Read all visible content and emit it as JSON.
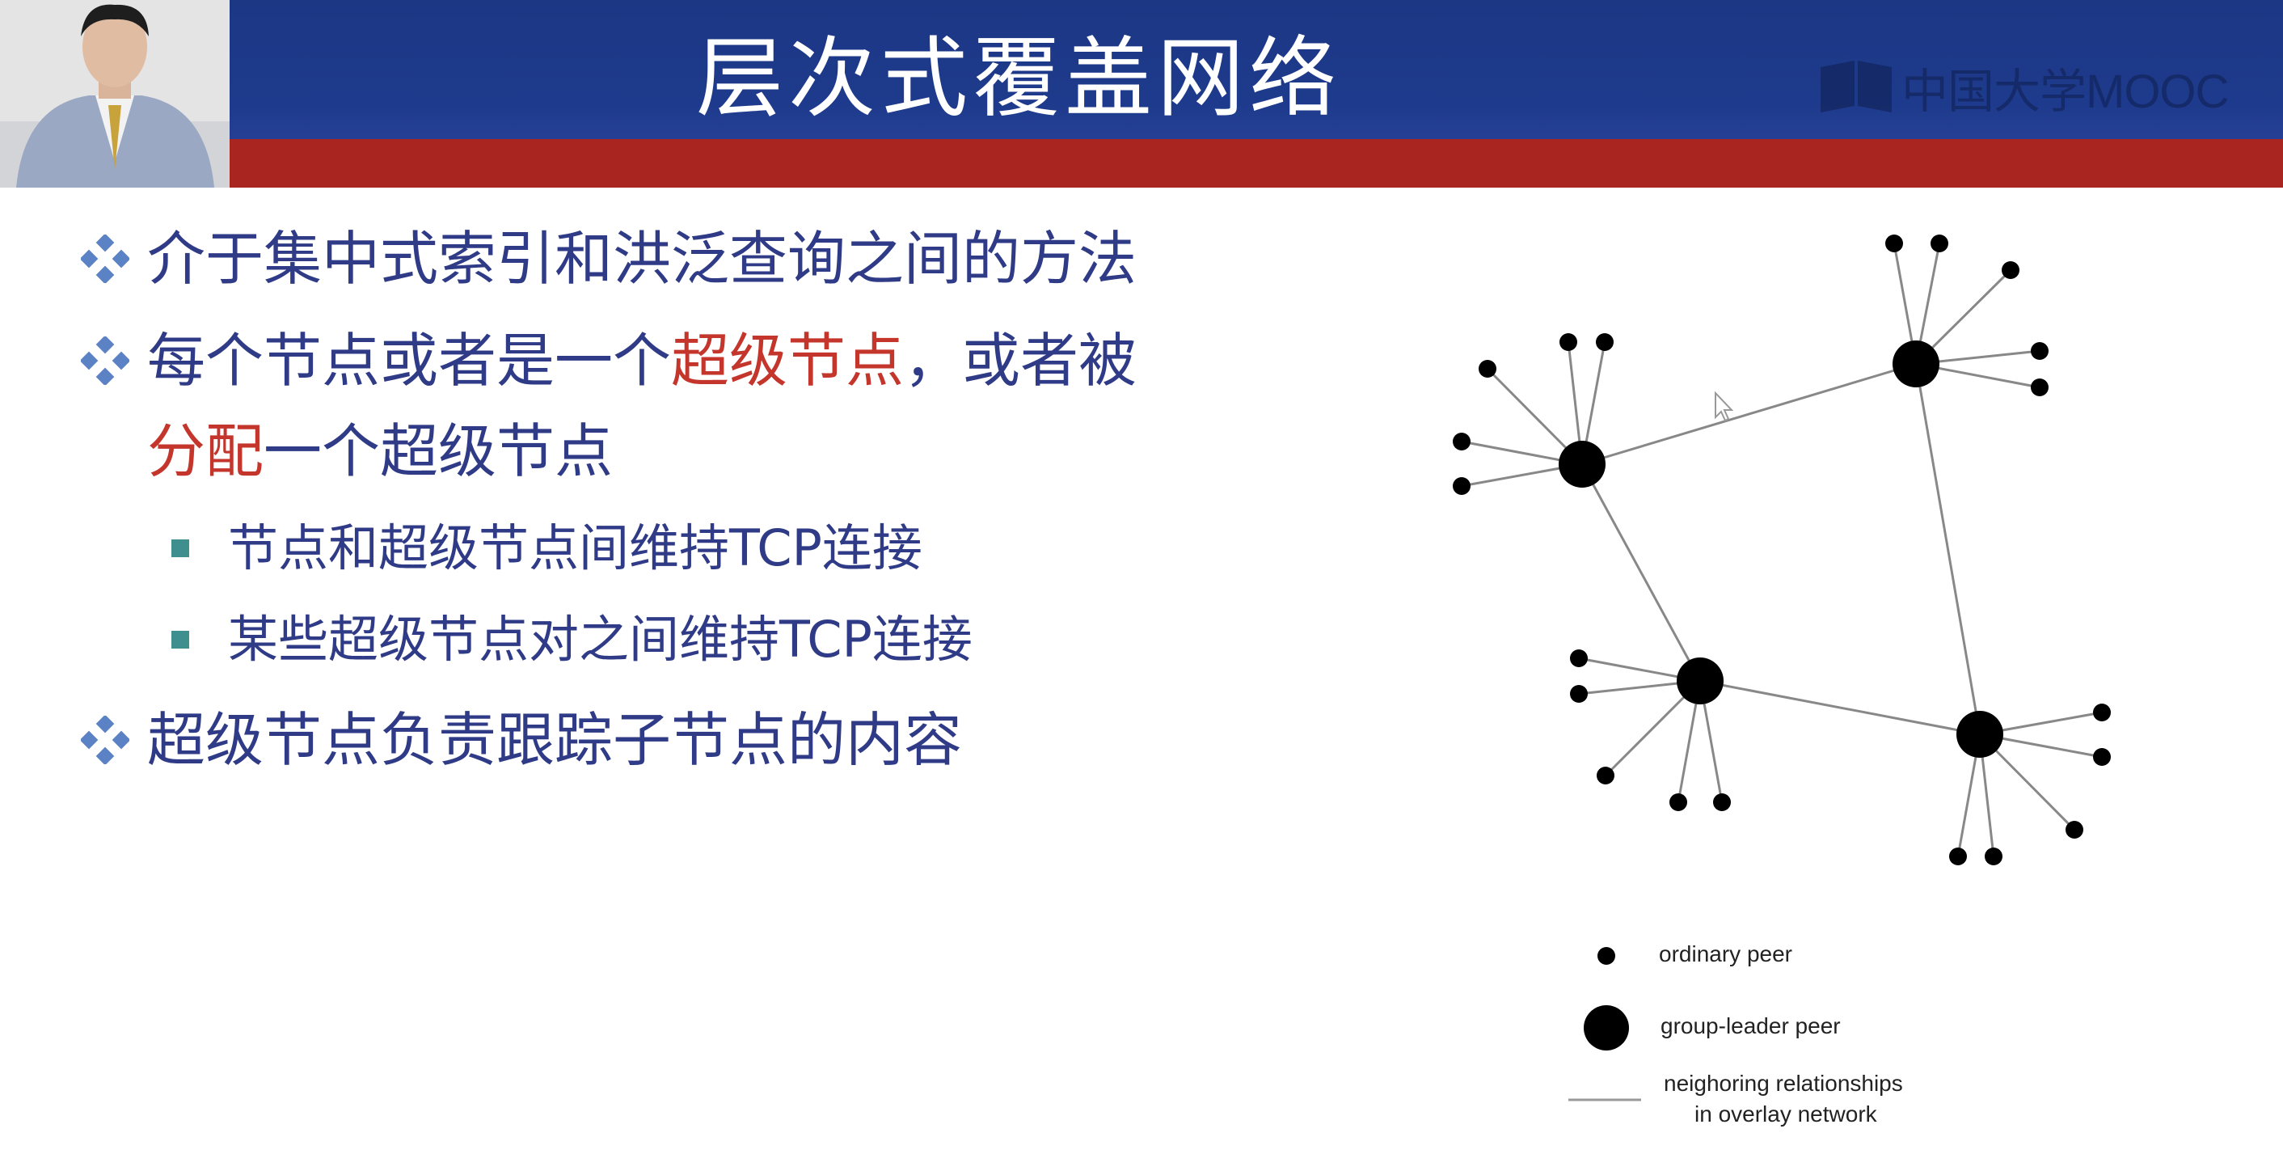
{
  "header": {
    "title": "层次式覆盖网络",
    "logo_text": "中国大学MOOC"
  },
  "bullets": [
    {
      "text": "介于集中式索引和洪泛查询之间的方法"
    },
    {
      "line1_prefix": "每个节点或者是一个",
      "line1_highlight": "超级节点",
      "line1_suffix": "，或者被",
      "line2_highlight": "分配",
      "line2_suffix": "一个超级节点"
    },
    {
      "text": "节点和超级节点间维持TCP连接"
    },
    {
      "text": "某些超级节点对之间维持TCP连接"
    },
    {
      "text": "超级节点负责跟踪子节点的内容"
    }
  ],
  "diagram": {
    "legend": {
      "ordinary_label": "ordinary peer",
      "leader_label": "group-leader peer",
      "neighbor_label_line1": "neighoring relationships",
      "neighbor_label_line2": "in overlay network"
    }
  },
  "colors": {
    "header_blue": "#1e3a8c",
    "header_red": "#a8261f",
    "text_blue": "#2f3b86",
    "highlight_red": "#c4352c",
    "bullet_square": "#3f8f8f"
  }
}
